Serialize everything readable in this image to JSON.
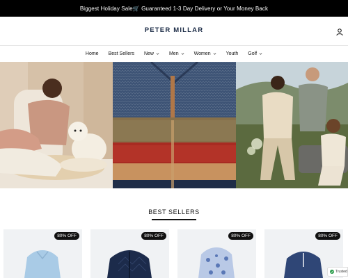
{
  "announcement": {
    "text": "Biggest Holiday Sale🛒 Guaranteed 1-3 Day Delivery or Your Money Back"
  },
  "header": {
    "logo": "PETER MILLAR",
    "account_icon": "user-icon"
  },
  "nav": {
    "items": [
      {
        "label": "Home",
        "dropdown": false
      },
      {
        "label": "Best Sellers",
        "dropdown": false
      },
      {
        "label": "New",
        "dropdown": true
      },
      {
        "label": "Men",
        "dropdown": true
      },
      {
        "label": "Women",
        "dropdown": true
      },
      {
        "label": "Youth",
        "dropdown": false
      },
      {
        "label": "Golf",
        "dropdown": true
      }
    ]
  },
  "hero": {
    "panels": [
      {
        "description_icon": "man-with-dog-photo"
      },
      {
        "description_icon": "stacked-sweaters-photo"
      },
      {
        "description_icon": "group-outdoor-photo"
      }
    ]
  },
  "best_sellers": {
    "title": "BEST SELLERS",
    "products": [
      {
        "badge": "80% OFF",
        "color": "#a9cbe6"
      },
      {
        "badge": "80% OFF",
        "color": "#1c2b4b"
      },
      {
        "badge": "80% OFF",
        "color": "#5a78b6"
      },
      {
        "badge": "80% OFF",
        "color": "#2f4676"
      }
    ]
  },
  "trust_badge": {
    "label": "Trusted"
  },
  "colors": {
    "announcement_bg": "#000000",
    "logo": "#1a2a45",
    "badge_bg": "#111111"
  }
}
